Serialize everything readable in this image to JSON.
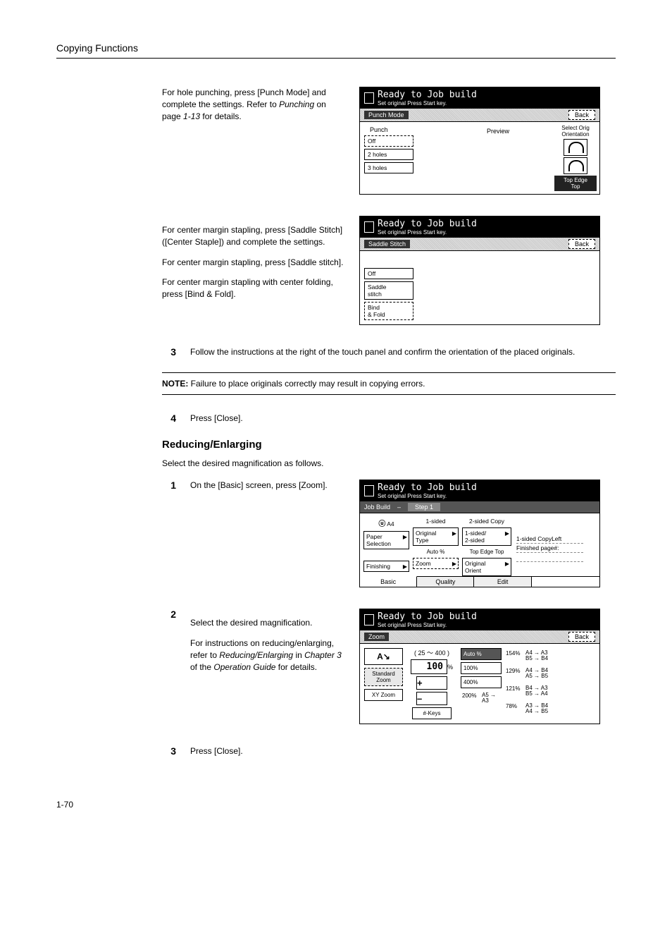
{
  "header": "Copying Functions",
  "para_punch": "For hole punching, press [Punch Mode] and complete the settings. Refer to ",
  "para_punch_ref": "Punching",
  "para_punch_tail": " on page ",
  "para_punch_page": "1-13",
  "para_punch_end": " for details.",
  "para_saddle1": "For center margin stapling, press [Saddle Stitch] ([Center Staple]) and complete the settings.",
  "para_saddle2": "For center margin stapling, press [Saddle stitch].",
  "para_saddle3": "For center margin stapling with center folding, press [Bind & Fold].",
  "step3": "Follow the instructions at the right of the touch panel and confirm the orientation of the placed originals.",
  "note_label": "NOTE:",
  "note_text": " Failure to place originals correctly may result in copying errors.",
  "step4": "Press [Close].",
  "heading_reduce": "Reducing/Enlarging",
  "reduce_intro": "Select the desired magnification as follows.",
  "reduce_step1": "On the [Basic] screen, press [Zoom].",
  "reduce_step2a": "Select the desired magnification.",
  "reduce_step2b": "For instructions on reducing/enlarging, refer to ",
  "reduce_step2b_ref": "Reducing/Enlarging",
  "reduce_step2b_mid": " in ",
  "reduce_step2b_ch": "Chapter 3",
  "reduce_step2b_tail": " of the ",
  "reduce_step2b_og": "Operation Guide",
  "reduce_step2b_end": " for details.",
  "reduce_step3": "Press [Close].",
  "page_number": "1-70",
  "steps": {
    "s3": "3",
    "s4": "4",
    "r1": "1",
    "r2": "2",
    "r3": "3"
  },
  "panel_ready_title": "Ready to Job build",
  "panel_ready_sub": "Set original Press Start key.",
  "punch_panel": {
    "bar_label": "Punch Mode",
    "back": "Back",
    "punch_label": "Punch",
    "preview": "Preview",
    "opts": [
      "Off",
      "2 holes",
      "3 holes"
    ],
    "orient_label": "Select Orig\nOrientation",
    "topedge": "Top Edge\nTop"
  },
  "saddle_panel": {
    "bar_label": "Saddle Stitch",
    "back": "Back",
    "opts": [
      "Off",
      "Saddle\nstitch",
      "Bind\n& Fold"
    ]
  },
  "jobbuild_panel": {
    "bar_left": "Job Build",
    "bar_dash": "–",
    "bar_step": "Step 1",
    "row1": {
      "a": "A4",
      "b": "1-sided",
      "c": "2-sided Copy"
    },
    "btns_l": [
      "Paper\nSelection",
      "Finishing"
    ],
    "btns_m": [
      "Original\nType",
      "Zoom"
    ],
    "label_m_top": "Auto %",
    "btns_r": [
      "1-sided/\n2-sided",
      "Original\nOrient"
    ],
    "label_r_top": "Top Edge Top",
    "right_lines": [
      "1-sided CopyLeft",
      "Finished page#:"
    ],
    "tabs": [
      "Basic",
      "Quality",
      "Edit"
    ]
  },
  "zoom_panel": {
    "bar_label": "Zoom",
    "back": "Back",
    "range": "( 25 ～ 400 )",
    "icon": "A↘",
    "percent": "100",
    "pct_sym": "%",
    "left_btns": [
      "Standard\nZoom",
      "XY Zoom"
    ],
    "mid_btns": [
      "+",
      "–",
      "#-Keys"
    ],
    "r1": [
      "Auto %",
      "100%",
      "400%",
      "200%"
    ],
    "r1_note": "A5 → A3",
    "r2": [
      {
        "p": "154%",
        "c": "A4 → A3\nB5 → B4"
      },
      {
        "p": "129%",
        "c": "A4 → B4\nA5 → B5"
      },
      {
        "p": "121%",
        "c": "B4 → A3\nB5 → A4"
      },
      {
        "p": "78%",
        "c": "A3 → B4\nA4 → B5"
      }
    ]
  }
}
